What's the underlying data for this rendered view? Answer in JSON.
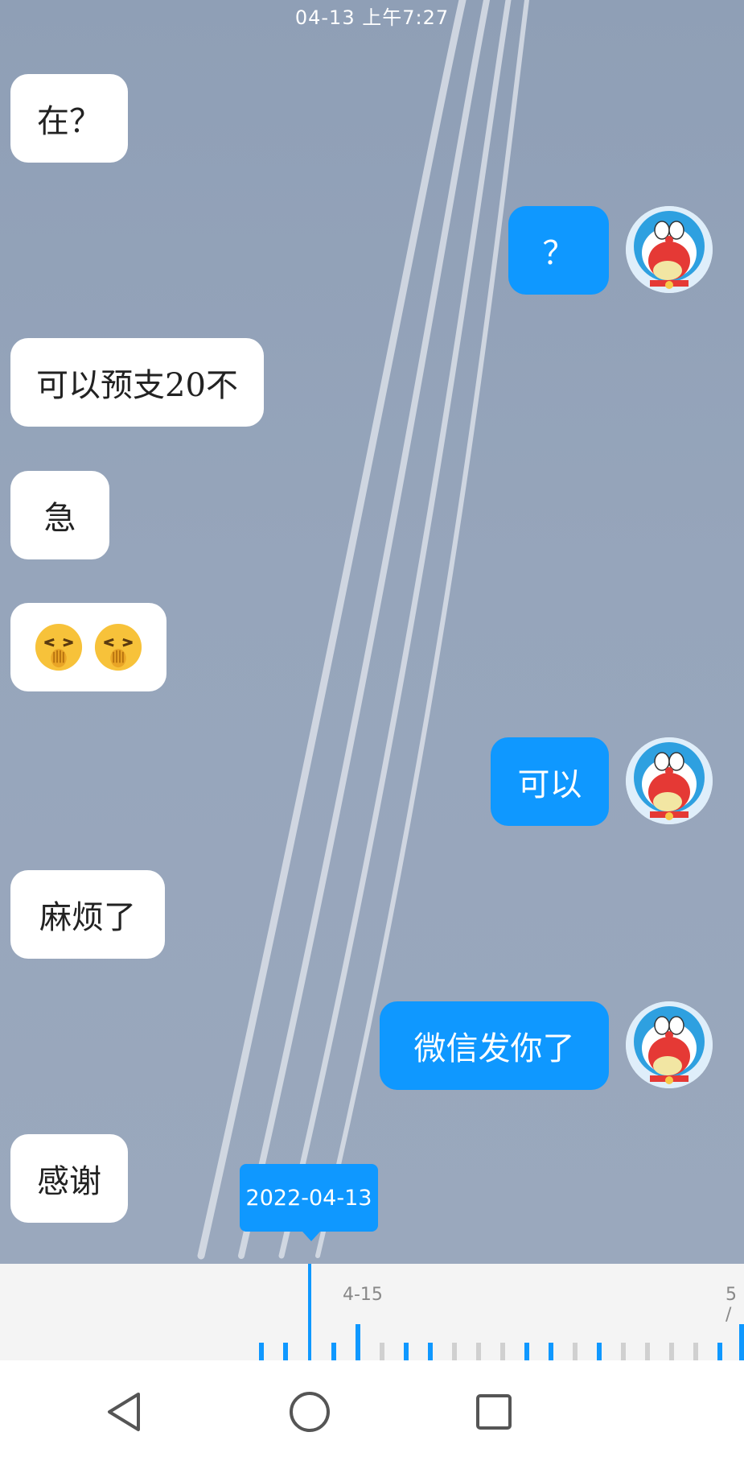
{
  "status": {
    "timestamp": "04-13  上午7:27"
  },
  "messages": [
    {
      "side": "in",
      "text": "在？"
    },
    {
      "side": "out",
      "text": "？"
    },
    {
      "side": "in",
      "text": "可以预支20不"
    },
    {
      "side": "in",
      "text": "急"
    },
    {
      "side": "in",
      "text": "",
      "emoji": [
        "face-palm-emoji",
        "face-palm-emoji"
      ]
    },
    {
      "side": "out",
      "text": "可以"
    },
    {
      "side": "in",
      "text": "麻烦了"
    },
    {
      "side": "out",
      "text": "微信发你了"
    },
    {
      "side": "in",
      "text": "感谢"
    }
  ],
  "timeline": {
    "selected_date": "2022-04-13",
    "labels": [
      "4-15",
      "5 /"
    ]
  },
  "nav": {
    "icons": [
      "back-triangle-icon",
      "home-circle-icon",
      "recents-square-icon"
    ]
  },
  "colors": {
    "accent": "#0f98ff",
    "bubble_in": "#ffffff",
    "timeline_bg": "#f4f4f4"
  }
}
